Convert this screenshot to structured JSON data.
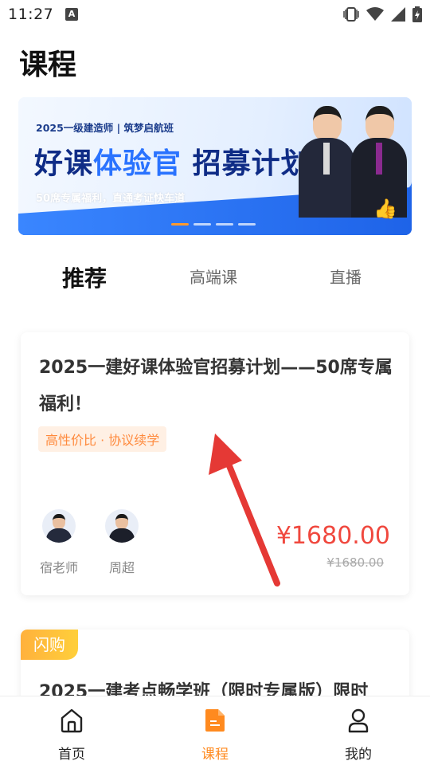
{
  "status_bar": {
    "time": "11:27",
    "notification_letter": "A"
  },
  "page": {
    "title": "课程"
  },
  "banner": {
    "subtitle": "2025一级建造师 | 筑梦启航班",
    "headline_part1": "好课",
    "headline_part2": "体验官",
    "headline_part3": "招募计划",
    "tagline": "50席专属福利，直通考证快车道"
  },
  "tabs": [
    {
      "label": "推荐",
      "active": true
    },
    {
      "label": "高端课",
      "active": false
    },
    {
      "label": "直播",
      "active": false
    }
  ],
  "course_card": {
    "title": "2025一建好课体验官招募计划——50席专属福利！",
    "tag": "高性价比 · 协议续学",
    "teachers": [
      {
        "name": "宿老师"
      },
      {
        "name": "周超"
      }
    ],
    "price": "¥1680.00",
    "original_price": "¥1680.00"
  },
  "course_card_2": {
    "badge": "闪购",
    "title": "2025一建考点畅学班（限时专属版）限时"
  },
  "bottom_nav": [
    {
      "label": "首页",
      "icon": "home-icon",
      "active": false
    },
    {
      "label": "课程",
      "icon": "course-document-icon",
      "active": true
    },
    {
      "label": "我的",
      "icon": "profile-icon",
      "active": false
    }
  ],
  "colors": {
    "accent": "#ff8a1f",
    "price": "#f0483e",
    "annotation_arrow": "#e53935"
  }
}
